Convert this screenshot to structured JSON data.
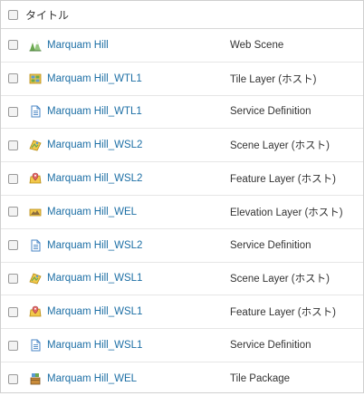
{
  "header": {
    "title": "タイトル"
  },
  "items": [
    {
      "name": "Marquam Hill",
      "type": "Web Scene",
      "icon": "web-scene-icon"
    },
    {
      "name": "Marquam Hill_WTL1",
      "type": "Tile Layer (ホスト)",
      "icon": "tile-layer-icon"
    },
    {
      "name": "Marquam Hill_WTL1",
      "type": "Service Definition",
      "icon": "service-definition-icon"
    },
    {
      "name": "Marquam Hill_WSL2",
      "type": "Scene Layer (ホスト)",
      "icon": "scene-layer-icon"
    },
    {
      "name": "Marquam Hill_WSL2",
      "type": "Feature Layer (ホスト)",
      "icon": "feature-layer-icon"
    },
    {
      "name": "Marquam Hill_WEL",
      "type": "Elevation Layer (ホスト)",
      "icon": "elevation-layer-icon"
    },
    {
      "name": "Marquam Hill_WSL2",
      "type": "Service Definition",
      "icon": "service-definition-icon"
    },
    {
      "name": "Marquam Hill_WSL1",
      "type": "Scene Layer (ホスト)",
      "icon": "scene-layer-icon"
    },
    {
      "name": "Marquam Hill_WSL1",
      "type": "Feature Layer (ホスト)",
      "icon": "feature-layer-icon"
    },
    {
      "name": "Marquam Hill_WSL1",
      "type": "Service Definition",
      "icon": "service-definition-icon"
    },
    {
      "name": "Marquam Hill_WEL",
      "type": "Tile Package",
      "icon": "tile-package-icon"
    }
  ]
}
